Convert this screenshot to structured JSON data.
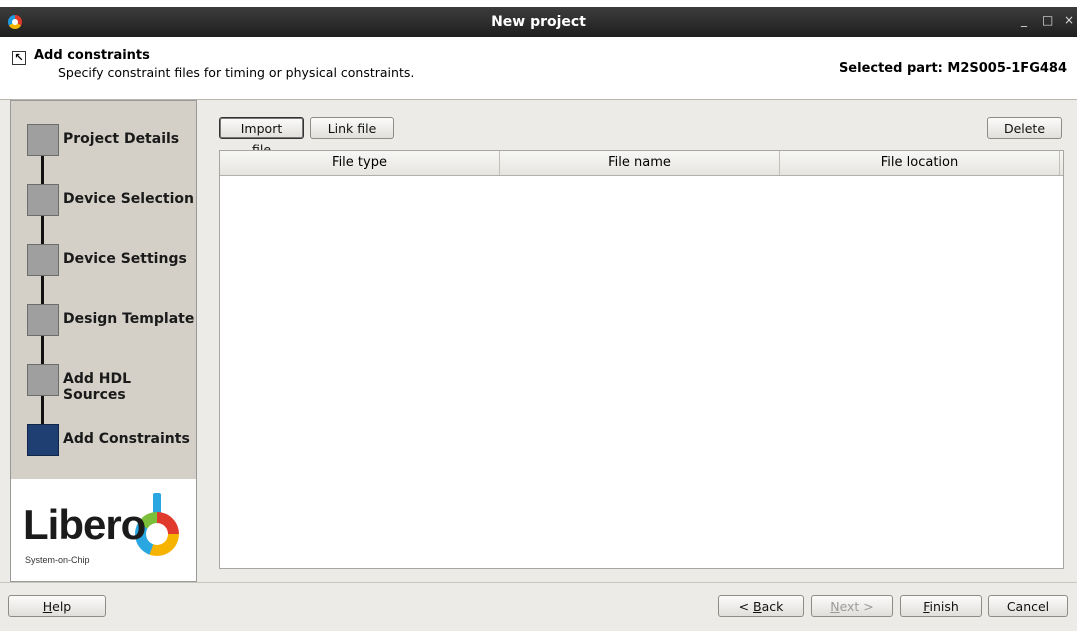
{
  "window": {
    "title": "New project",
    "minimize_glyph": "_",
    "maximize_glyph": "□",
    "close_glyph": "×",
    "icon": "libero-app-icon"
  },
  "header": {
    "title": "Add constraints",
    "subtitle": "Specify constraint files for timing or physical constraints.",
    "selected_part": "Selected part: M2S005-1FG484",
    "icon": "wizard-pointer-icon"
  },
  "steps": [
    {
      "label": "Project Details",
      "active": false
    },
    {
      "label": "Device Selection",
      "active": false
    },
    {
      "label": "Device Settings",
      "active": false
    },
    {
      "label": "Design Template",
      "active": false
    },
    {
      "label": "Add HDL Sources",
      "active": false
    },
    {
      "label": "Add Constraints",
      "active": true
    }
  ],
  "logo": {
    "text": "Libero",
    "subtitle": "System-on-Chip"
  },
  "toolbar": {
    "import_label": "Import file",
    "link_label": "Link file",
    "delete_label": "Delete"
  },
  "table": {
    "columns": [
      "File type",
      "File name",
      "File location"
    ],
    "rows": []
  },
  "footer": {
    "help_label": "Help",
    "back_label": "< Back",
    "next_label": "Next >",
    "finish_label": "Finish",
    "cancel_label": "Cancel"
  },
  "colors": {
    "active_step": "#1f3f73",
    "inactive_step": "#9f9f9f",
    "titlebar": "#2a2a2a"
  }
}
